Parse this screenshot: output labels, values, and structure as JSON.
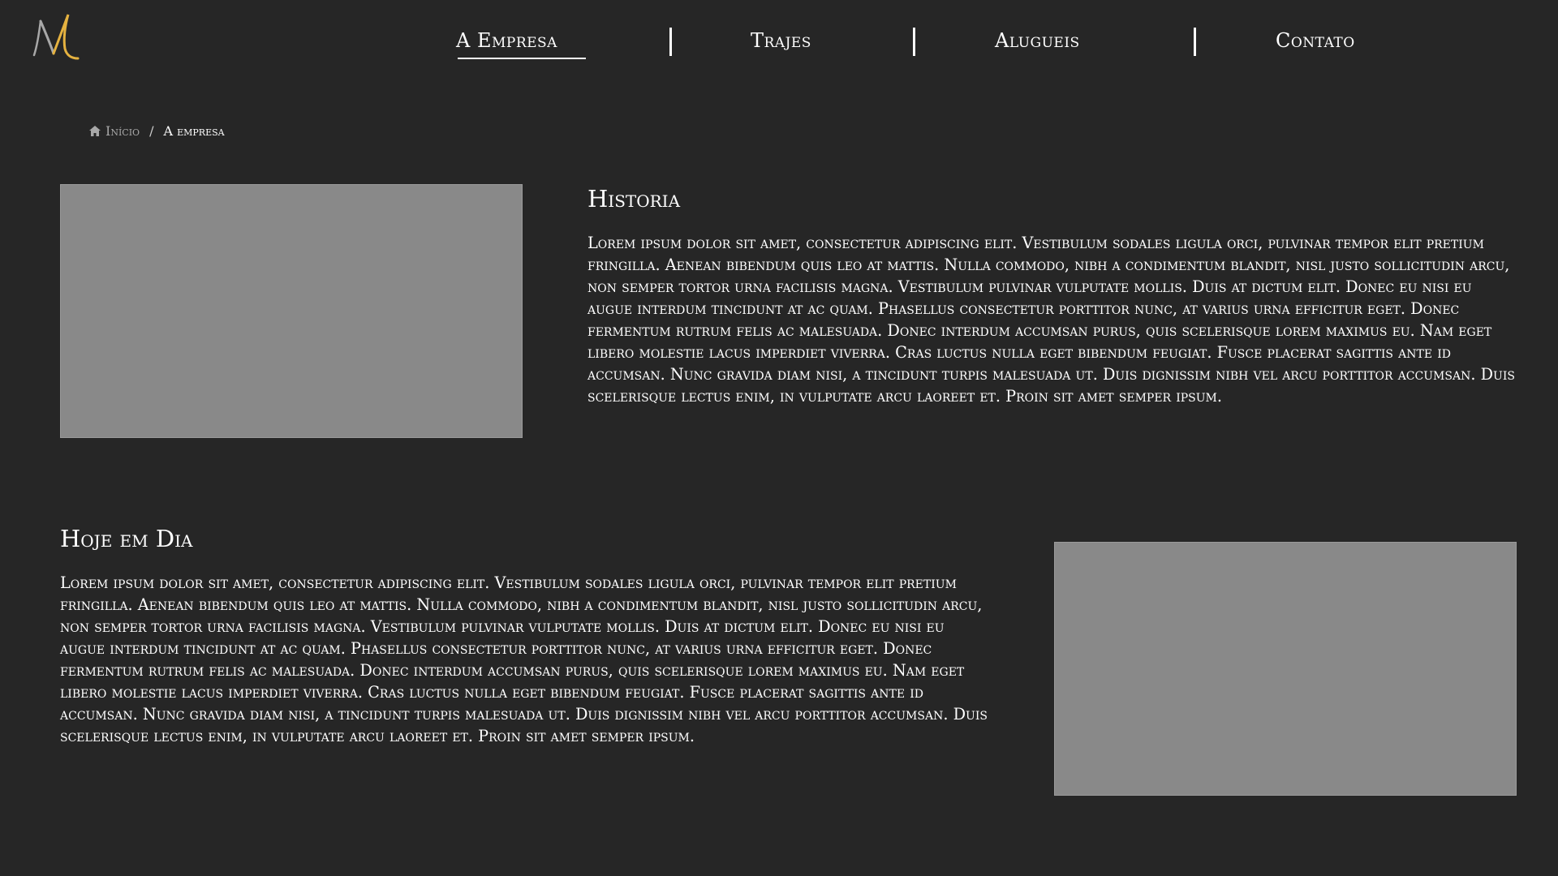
{
  "logo": {
    "letter": "M",
    "colors": {
      "gold": "#e5b240",
      "silver": "#a8a8a8"
    }
  },
  "nav": {
    "items": [
      {
        "label": "A Empresa",
        "active": true
      },
      {
        "label": "Trajes",
        "active": false
      },
      {
        "label": "Alugueis",
        "active": false
      },
      {
        "label": "Contato",
        "active": false
      }
    ]
  },
  "breadcrumb": {
    "home_icon": "home-icon",
    "home_label": "Início",
    "separator": "/",
    "current": "A empresa"
  },
  "sections": {
    "historia": {
      "title": "Historia",
      "body": "Lorem ipsum dolor sit amet, consectetur adipiscing elit. Vestibulum sodales ligula orci, pulvinar tempor elit pretium fringilla. Aenean bibendum quis leo at mattis. Nulla commodo, nibh a condimentum blandit, nisl justo sollicitudin arcu, non semper tortor urna facilisis magna. Vestibulum pulvinar vulputate mollis. Duis at dictum elit. Donec eu nisi eu augue interdum tincidunt at ac quam. Phasellus consectetur porttitor nunc, at varius urna efficitur eget. Donec fermentum rutrum felis ac malesuada. Donec interdum accumsan purus, quis scelerisque lorem maximus eu. Nam eget libero molestie lacus imperdiet viverra. Cras luctus nulla eget bibendum feugiat. Fusce placerat sagittis ante id accumsan. Nunc gravida diam nisi, a tincidunt turpis malesuada ut. Duis dignissim nibh vel arcu porttitor accumsan. Duis scelerisque lectus enim, in vulputate arcu laoreet et. Proin sit amet semper ipsum."
    },
    "hoje": {
      "title": "Hoje em Dia",
      "body": "Lorem ipsum dolor sit amet, consectetur adipiscing elit. Vestibulum sodales ligula orci, pulvinar tempor elit pretium fringilla. Aenean bibendum quis leo at mattis. Nulla commodo, nibh a condimentum blandit, nisl justo sollicitudin arcu, non semper tortor urna facilisis magna. Vestibulum pulvinar vulputate mollis. Duis at dictum elit. Donec eu nisi eu augue interdum tincidunt at ac quam. Phasellus consectetur porttitor nunc, at varius urna efficitur eget. Donec fermentum rutrum felis ac malesuada. Donec interdum accumsan purus, quis scelerisque lorem maximus eu. Nam eget libero molestie lacus imperdiet viverra. Cras luctus nulla eget bibendum feugiat. Fusce placerat sagittis ante id accumsan. Nunc gravida diam nisi, a tincidunt turpis malesuada ut. Duis dignissim nibh vel arcu porttitor accumsan. Duis scelerisque lectus enim, in vulputate arcu laoreet et. Proin sit amet semper ipsum."
    }
  },
  "colors": {
    "background": "#262626",
    "image_placeholder": "#898989",
    "text": "#ffffff",
    "muted": "#a8a8a8"
  }
}
